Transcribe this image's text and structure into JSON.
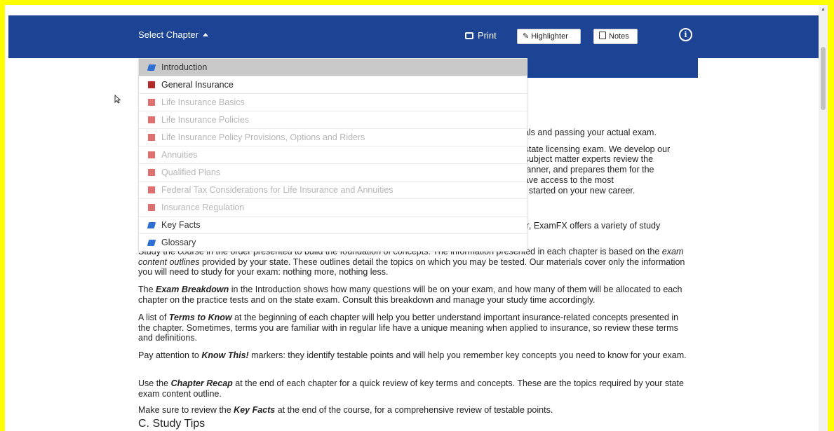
{
  "toolbar": {
    "select_chapter": "Select Chapter",
    "print": "Print",
    "highlighter": "Highlighter",
    "notes": "Notes",
    "info": "i"
  },
  "chapters": [
    {
      "label": "Introduction",
      "icon": "book-icon",
      "state": "selected"
    },
    {
      "label": "General Insurance",
      "icon": "chapter-square-icon",
      "state": "active"
    },
    {
      "label": "Life Insurance Basics",
      "icon": "chapter-square-icon",
      "state": "locked"
    },
    {
      "label": "Life Insurance Policies",
      "icon": "chapter-square-icon",
      "state": "locked"
    },
    {
      "label": "Life Insurance Policy Provisions, Options and Riders",
      "icon": "chapter-square-icon",
      "state": "locked"
    },
    {
      "label": "Annuities",
      "icon": "chapter-square-icon",
      "state": "locked"
    },
    {
      "label": "Qualified Plans",
      "icon": "chapter-square-icon",
      "state": "locked"
    },
    {
      "label": "Federal Tax Considerations for Life Insurance and Annuities",
      "icon": "chapter-square-icon",
      "state": "locked"
    },
    {
      "label": "Insurance Regulation",
      "icon": "chapter-square-icon",
      "state": "locked"
    },
    {
      "label": "Key Facts",
      "icon": "book-icon",
      "state": "link"
    },
    {
      "label": "Glossary",
      "icon": "book-icon",
      "state": "link"
    }
  ],
  "fragments": [
    "rials and passing your actual exam.",
    "r state licensing exam. We develop our",
    "r subject matter experts review the",
    "manner, and prepares them for the",
    "have access to the most",
    "et started on your new career.",
    "tor, ExamFX offers a variety of study"
  ],
  "paragraphs": {
    "p1_a": "Study the course in the order presented to build the foundation of concepts. The information presented in each chapter is based on the ",
    "p1_em": "exam content outlines",
    "p1_b": " provided by your state. These outlines detail the topics on which you may be tested. Our materials cover only the information you will need to study for your exam: nothing more, nothing less.",
    "p2_a": "The ",
    "p2_b": "Exam Breakdown",
    "p2_c": " in the Introduction shows how many questions will be on your exam, and how many of them will be allocated to each chapter on the practice tests and on the state exam. Consult this breakdown and manage your study time accordingly.",
    "p3_a": "A list of ",
    "p3_b": "Terms to Know",
    "p3_c": " at the beginning of each chapter will help you better understand important insurance-related concepts presented in the chapter. Sometimes, terms you are familiar with in regular life have a unique meaning when applied to insurance, so review these terms and definitions.",
    "p4_a": "Pay attention to ",
    "p4_b": "Know This!",
    "p4_c": " markers: they identify testable points and will help you remember key concepts you need to know for your exam.",
    "p5_a": "Use the ",
    "p5_b": "Chapter Recap",
    "p5_c": " at the end of each chapter for a quick review of key terms and concepts. These are the topics required by your state exam content outline.",
    "p6_a": "Make sure to review the ",
    "p6_b": "Key Facts",
    "p6_c": " at the end of the course, for a comprehensive review of testable points."
  },
  "section_heading": "C. Study Tips",
  "colors": {
    "frame": "#ffff00",
    "header": "#1d4394",
    "chapter_active": "#b22a2a",
    "chapter_locked": "#df6f6f",
    "book": "#2f6fd1"
  }
}
